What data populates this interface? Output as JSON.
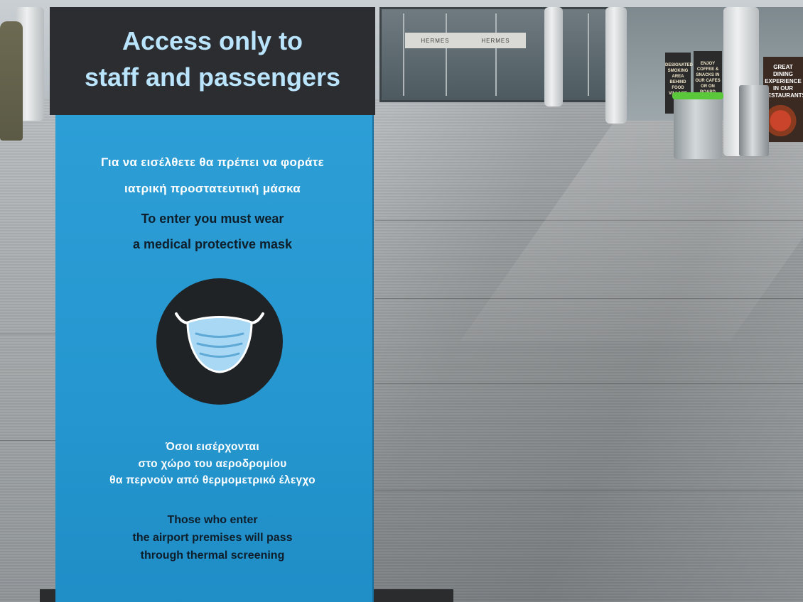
{
  "scene": {
    "entrance_sign_text": [
      "HERMES",
      "HERMES"
    ],
    "ad_boards": [
      "DESIGNATED SMOKING AREA BEHIND FOOD VILLAGE",
      "ENJOY COFFEE & SNACKS IN OUR CAFES OR ON BOARD",
      "GREAT DINING EXPERIENCE IN OUR RESTAURANTS"
    ]
  },
  "sign": {
    "title": "Access only to\nstaff and passengers",
    "greek_mask_notice": "Για να εισέλθετε θα πρέπει να φοράτε\nιατρική προστατευτική μάσκα",
    "english_mask_notice": "To enter you must wear\na medical protective mask",
    "greek_screening_notice": "Όσοι εισέρχονται\nστο χώρο του αεροδρομίου\nθα περνούν από θερμομετρικό έλεγχο",
    "english_screening_notice": "Those who enter\nthe airport premises will pass\nthrough thermal screening",
    "icon": "face-mask-icon",
    "colors": {
      "header": "#2b2d31",
      "title": "#b9e4fb",
      "body": "#2596cf",
      "mask": "#a9d8f5"
    }
  }
}
